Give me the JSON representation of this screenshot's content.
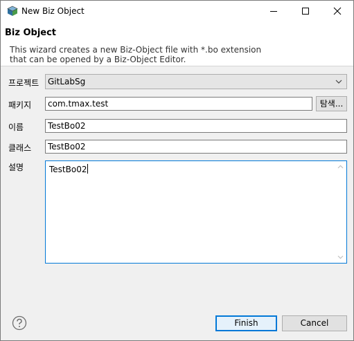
{
  "window": {
    "title": "New Biz Object",
    "controls": [
      "minimize-icon",
      "maximize-icon",
      "close-icon"
    ]
  },
  "banner": {
    "title": "Biz Object",
    "description": "This wizard creates a new Biz-Object file with *.bo extension that can be opened by a Biz-Object Editor."
  },
  "form": {
    "project_label": "프로젝트",
    "project_value": "GitLabSg",
    "package_label": "패키지",
    "package_value": "com.tmax.test",
    "browse_label": "탐색...",
    "name_label": "이름",
    "name_value": "TestBo02",
    "class_label": "클래스",
    "class_value": "TestBo02",
    "description_label": "설명",
    "description_value": "TestBo02"
  },
  "footer": {
    "finish_label": "Finish",
    "cancel_label": "Cancel",
    "help_icon": "help-icon"
  },
  "colors": {
    "focus_border": "#0078d7",
    "background": "#f0f0f0"
  }
}
